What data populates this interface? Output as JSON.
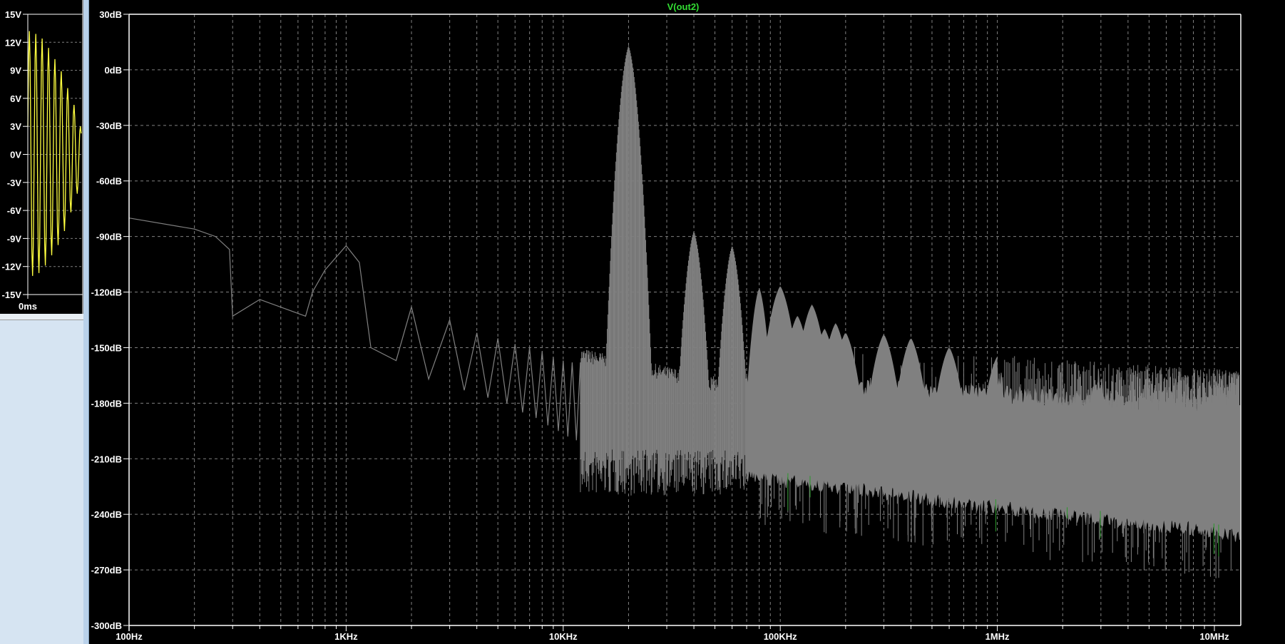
{
  "left_pane": {
    "y_ticks": [
      "15V",
      "12V",
      "9V",
      "6V",
      "3V",
      "0V",
      "-3V",
      "-6V",
      "-9V",
      "-12V",
      "-15V"
    ],
    "x_label": "0ms",
    "trace_color": "#ffff40",
    "peaks_v": [
      13.2,
      -13.0,
      12.9,
      -12.7,
      12.4,
      -11.9,
      11.4,
      -10.8,
      10.2,
      -9.7,
      8.9,
      -8.2,
      7.1,
      -6.2,
      5.3,
      -4.2,
      3.0
    ]
  },
  "chart_data": {
    "type": "line",
    "title": "V(out2)",
    "title_color": "#33dd33",
    "xscale": "log",
    "xlim": [
      100,
      13000000
    ],
    "ylim": [
      -300,
      30
    ],
    "grid": true,
    "x_ticks": [
      {
        "f": 100,
        "label": "100Hz"
      },
      {
        "f": 1000,
        "label": "1KHz"
      },
      {
        "f": 10000,
        "label": "10KHz"
      },
      {
        "f": 100000,
        "label": "100KHz"
      },
      {
        "f": 1000000,
        "label": "1MHz"
      },
      {
        "f": 10000000,
        "label": "10MHz"
      }
    ],
    "y_ticks": [
      {
        "v": 30,
        "label": "30dB"
      },
      {
        "v": 0,
        "label": "0dB"
      },
      {
        "v": -30,
        "label": "-30dB"
      },
      {
        "v": -60,
        "label": "-60dB"
      },
      {
        "v": -90,
        "label": "-90dB"
      },
      {
        "v": -120,
        "label": "-120dB"
      },
      {
        "v": -150,
        "label": "-150dB"
      },
      {
        "v": -180,
        "label": "-180dB"
      },
      {
        "v": -210,
        "label": "-210dB"
      },
      {
        "v": -240,
        "label": "-240dB"
      },
      {
        "v": -270,
        "label": "-270dB"
      },
      {
        "v": -300,
        "label": "-300dB"
      }
    ],
    "series_color": "#808080",
    "low_freq_trace": [
      [
        100,
        -80
      ],
      [
        200,
        -86
      ],
      [
        250,
        -90
      ],
      [
        290,
        -97
      ],
      [
        300,
        -133
      ],
      [
        400,
        -124
      ],
      [
        650,
        -133
      ],
      [
        700,
        -120
      ],
      [
        800,
        -108
      ],
      [
        1000,
        -95
      ],
      [
        1150,
        -104
      ],
      [
        1300,
        -150
      ],
      [
        1700,
        -157
      ],
      [
        2000,
        -128
      ],
      [
        2400,
        -167
      ],
      [
        3000,
        -135
      ],
      [
        3500,
        -173
      ],
      [
        4000,
        -142
      ],
      [
        4500,
        -177
      ],
      [
        5000,
        -145
      ],
      [
        5500,
        -180
      ],
      [
        6000,
        -148
      ],
      [
        6500,
        -185
      ],
      [
        7000,
        -150
      ],
      [
        7500,
        -188
      ],
      [
        8000,
        -152
      ],
      [
        8500,
        -192
      ],
      [
        9000,
        -155
      ],
      [
        9500,
        -195
      ],
      [
        10000,
        -157
      ],
      [
        10500,
        -198
      ],
      [
        11000,
        -158
      ],
      [
        11500,
        -200
      ],
      [
        12000,
        -158
      ]
    ],
    "peaks": [
      {
        "f": 20000,
        "dB": 13
      },
      {
        "f": 40000,
        "dB": -87
      },
      {
        "f": 60000,
        "dB": -95
      },
      {
        "f": 80000,
        "dB": -118
      },
      {
        "f": 100000,
        "dB": -117
      },
      {
        "f": 120000,
        "dB": -133
      },
      {
        "f": 140000,
        "dB": -127
      },
      {
        "f": 160000,
        "dB": -140
      },
      {
        "f": 180000,
        "dB": -137
      },
      {
        "f": 200000,
        "dB": -142
      },
      {
        "f": 300000,
        "dB": -143
      },
      {
        "f": 400000,
        "dB": -145
      },
      {
        "f": 600000,
        "dB": -150
      },
      {
        "f": 1000000,
        "dB": -155
      },
      {
        "f": 3000000,
        "dB": -158
      },
      {
        "f": 10000000,
        "dB": -162
      }
    ],
    "noise_band": {
      "upper": [
        [
          70000,
          -175
        ],
        [
          1000000,
          -180
        ],
        [
          10000000,
          -190
        ],
        [
          13000000,
          -190
        ]
      ],
      "lower": [
        [
          70000,
          -215
        ],
        [
          1000000,
          -232
        ],
        [
          10000000,
          -245
        ],
        [
          13000000,
          -248
        ]
      ]
    }
  }
}
